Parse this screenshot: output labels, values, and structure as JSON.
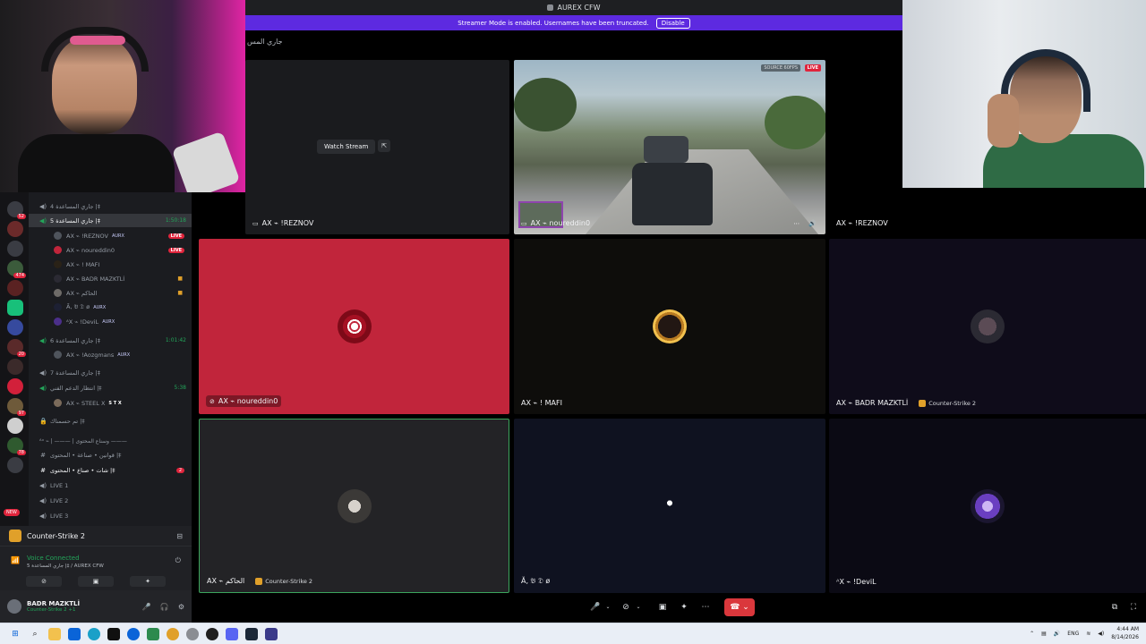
{
  "window": {
    "title": "AUREX CFW"
  },
  "banner": {
    "text": "Streamer Mode is enabled. Usernames have been truncated.",
    "button": "Disable"
  },
  "header": {
    "channel": "جاري المس"
  },
  "sidebar": {
    "channels": [
      {
        "label": "جاري المساعدة 4 |‡",
        "time": ""
      },
      {
        "label": "جاري المساعدة 5 |‡",
        "time": "1:50:18"
      },
      {
        "label": "جاري المساعدة 6 |‡",
        "time": "1:01:42"
      },
      {
        "label": "جاري المساعدة 7 |‡",
        "time": ""
      },
      {
        "label": "انتظار الدعم الفني |‡",
        "time": "5:38"
      },
      {
        "label": "تم حسمناك |‡",
        "time": ""
      },
      {
        "label": "ᴬˣ ⌁ | ——— | وسناع المحتوى ———",
        "time": ""
      },
      {
        "label": "قوانين • صناعة • المحتوى |‡",
        "time": ""
      },
      {
        "label": "شات • صناع • المحتوى |‡",
        "time": "2"
      },
      {
        "label": "LIVE 1",
        "time": ""
      },
      {
        "label": "LIVE 2",
        "time": ""
      },
      {
        "label": "LIVE 3",
        "time": ""
      }
    ],
    "members": [
      {
        "name": "AX ⌁ !REZNOV",
        "tag": "AURX",
        "live": "LIVE"
      },
      {
        "name": "AX ⌁ noureddin0",
        "tag": "",
        "live": "LIVE"
      },
      {
        "name": "AX ⌁ ! MAFI",
        "tag": "",
        "live": ""
      },
      {
        "name": "AX ⌁ BADR MAZKTLİ",
        "tag": "",
        "live": ""
      },
      {
        "name": "AX ⌁ الحاكم",
        "tag": "",
        "live": ""
      },
      {
        "name": "Ă‚ 𝔅 𝔇 ø",
        "tag": "AURX",
        "live": ""
      },
      {
        "name": "ᴬX ⌁ !DeviL",
        "tag": "AURX",
        "live": ""
      },
      {
        "name": "AX ⌁ !Aozgmans",
        "tag": "AURX",
        "live": ""
      },
      {
        "name": "AX ⌁ STEEL X",
        "tag": "S T X",
        "live": ""
      }
    ],
    "server_badges": [
      "52",
      "474",
      "20",
      "97",
      "78",
      "NEW"
    ]
  },
  "activity": {
    "game": "Counter-Strike 2"
  },
  "voice": {
    "status": "Voice Connected",
    "channel": "جاري المساعدة 5 |‡ / AUREX CFW"
  },
  "user": {
    "name": "BADR MAZKTLİ",
    "status": "Counter-Strike 2 +1"
  },
  "tiles": {
    "t1": {
      "watch": "Watch Stream",
      "name": "AX ⌁ !REZNOV"
    },
    "t2": {
      "name": "AX ⌁ noureddin0",
      "source": "SOURCE 60FPS",
      "live": "LIVE"
    },
    "t3": {
      "name": "AX ⌁ !REZNOV"
    },
    "t4": {
      "name": "AX ⌁ noureddin0"
    },
    "t5": {
      "name": "AX ⌁ ! MAFI"
    },
    "t6": {
      "name": "AX ⌁ BADR MAZKTLİ",
      "game": "Counter-Strike 2"
    },
    "t7": {
      "name": "AX ⌁ الحاكم",
      "game": "Counter-Strike 2"
    },
    "t8": {
      "name": "Ă‚ 𝔅 𝔇 ø"
    },
    "t9": {
      "name": "ᴬX ⌁ !DeviL"
    }
  },
  "taskbar": {
    "lang": "ENG",
    "time": "4:44 AM",
    "date": "8/14/2026"
  },
  "colors": {
    "accent": "#5d2ae0",
    "live": "#e0243c",
    "online": "#23a55a",
    "hangup": "#da373c"
  }
}
